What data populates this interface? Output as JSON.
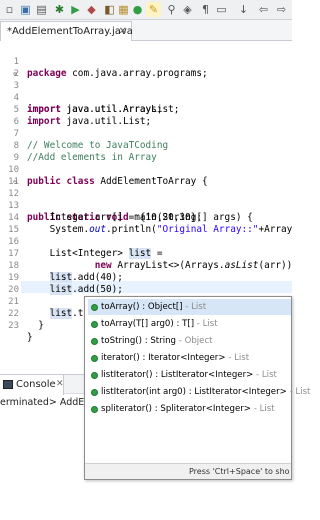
{
  "toolbar": {
    "icons": [
      "new-file-icon",
      "save-icon",
      "print-icon",
      "debug-icon",
      "run-icon",
      "external-tools-icon",
      "new-java-project-icon",
      "new-package-icon",
      "new-class-icon",
      "open-type-icon",
      "search-icon",
      "toggle-mark-occurrences-icon",
      "edit-icon",
      "show-whitespace-icon",
      "next-annotation-icon",
      "back-icon",
      "forward-icon"
    ]
  },
  "editor_tab": {
    "title": "*AddElementToArray.java",
    "close_label": "✕"
  },
  "code": {
    "lines": [
      {
        "n": "1",
        "text": "package com.java.array.programs;"
      },
      {
        "n": "2",
        "text": ""
      },
      {
        "n": "3",
        "text": "import java.util.ArrayList;"
      },
      {
        "n": "4",
        "text": "import java.util.Arrays;"
      },
      {
        "n": "5",
        "text": "import java.util.List;"
      },
      {
        "n": "6",
        "text": ""
      },
      {
        "n": "7",
        "text": "// Welcome to JavaTCoding"
      },
      {
        "n": "8",
        "text": "//Add elements in Array"
      },
      {
        "n": "9",
        "text": ""
      },
      {
        "n": "10",
        "text": "public class AddElementToArray {"
      },
      {
        "n": "11",
        "text": ""
      },
      {
        "n": "12",
        "text": "public static void main(String[] args) {"
      },
      {
        "n": "13",
        "text": "Integer arr[] = {10,20,30};"
      },
      {
        "n": "14",
        "text": "System.out.println(\"Original Array::\"+Array"
      },
      {
        "n": "15",
        "text": ""
      },
      {
        "n": "16",
        "text": "List<Integer> list ="
      },
      {
        "n": "17",
        "text": "new ArrayList<>(Arrays.asList(arr));"
      },
      {
        "n": "18",
        "text": "list.add(40);"
      },
      {
        "n": "19",
        "text": "list.add(50);"
      },
      {
        "n": "20",
        "text": ""
      },
      {
        "n": "21",
        "text": "list.to"
      },
      {
        "n": "22",
        "text": "}"
      },
      {
        "n": "23",
        "text": "}"
      }
    ]
  },
  "proposals": {
    "items": [
      {
        "name": "toArray() : Object[]",
        "type": " - List"
      },
      {
        "name": "toArray(T[] arg0) : T[]",
        "type": " - List"
      },
      {
        "name": "toString() : String",
        "type": " - Object"
      },
      {
        "name": "iterator() : Iterator<Integer>",
        "type": " - List"
      },
      {
        "name": "listIterator() : ListIterator<Integer>",
        "type": " - List"
      },
      {
        "name": "listIterator(int arg0) : ListIterator<Integer>",
        "type": " - List"
      },
      {
        "name": "spliterator() : Spliterator<Integer>",
        "type": " - List"
      }
    ],
    "footer": "Press 'Ctrl+Space' to sho"
  },
  "console": {
    "tab_label": "Console",
    "close_label": "✕",
    "status": "erminated> AddEl"
  }
}
